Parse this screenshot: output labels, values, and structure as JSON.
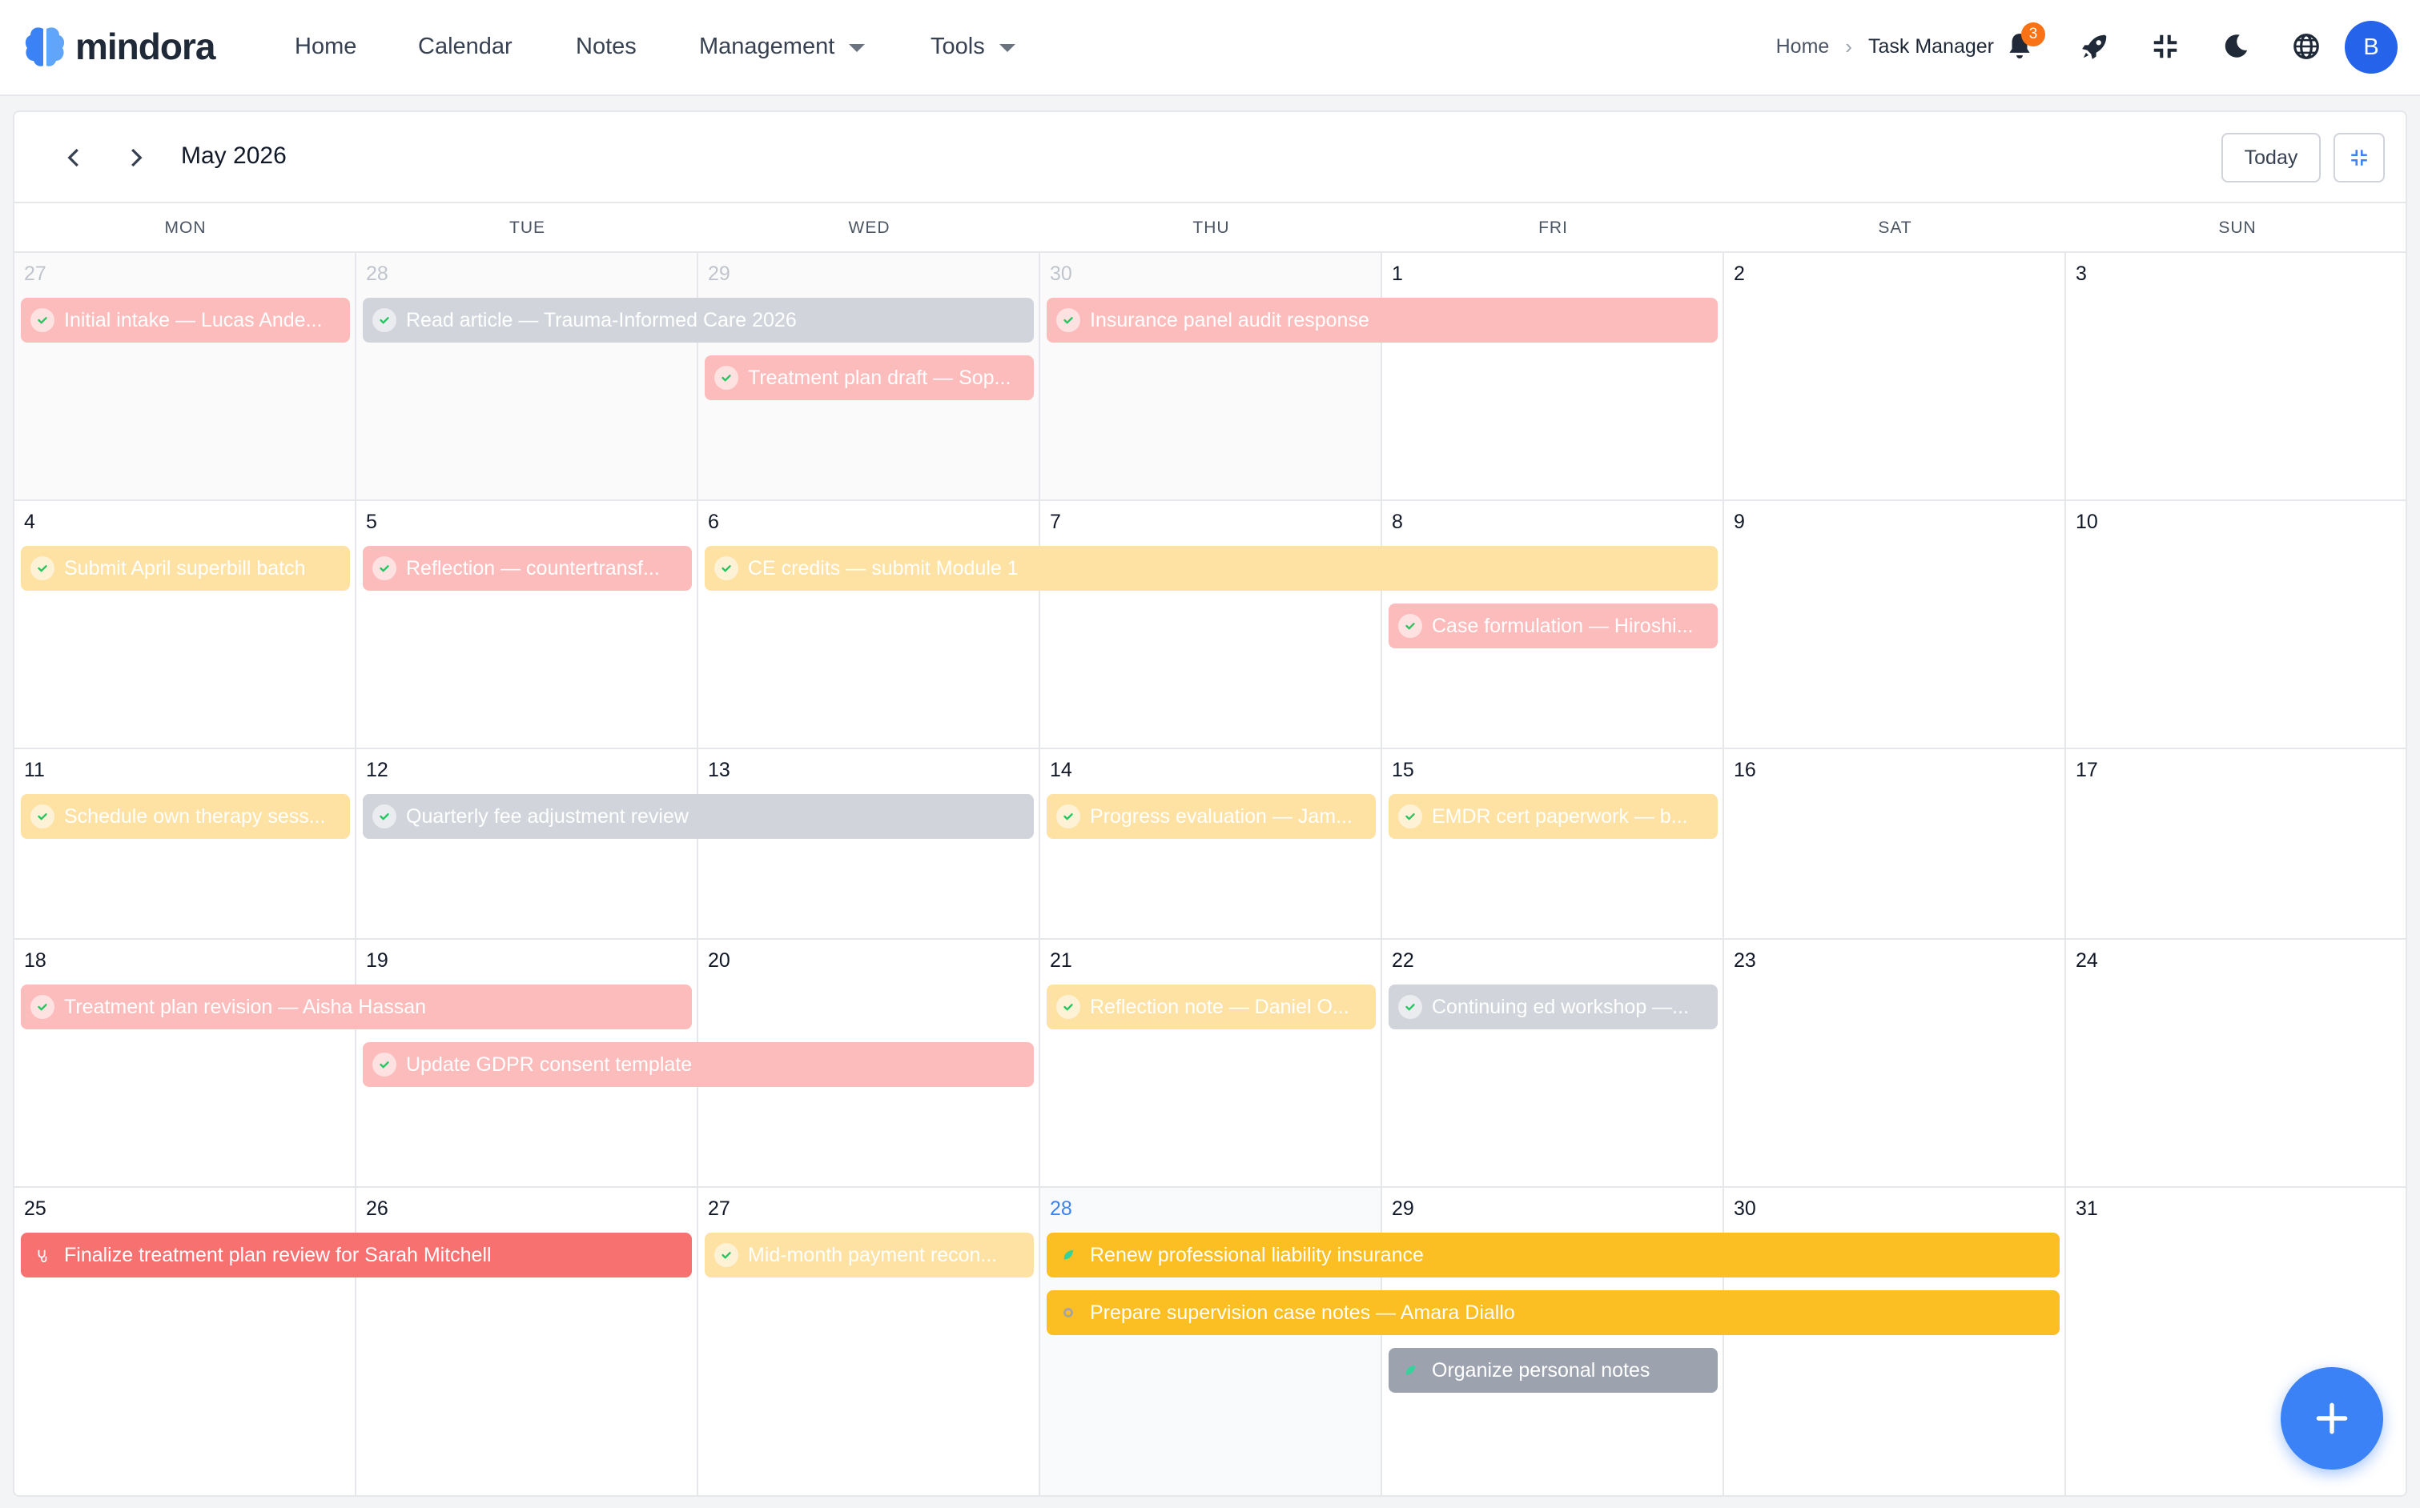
{
  "app": {
    "brand": "mindora"
  },
  "nav": {
    "items": [
      {
        "label": "Home",
        "dropdown": false
      },
      {
        "label": "Calendar",
        "dropdown": false
      },
      {
        "label": "Notes",
        "dropdown": false
      },
      {
        "label": "Management",
        "dropdown": true
      },
      {
        "label": "Tools",
        "dropdown": true
      }
    ]
  },
  "breadcrumb": {
    "home": "Home",
    "separator": "›",
    "current": "Task Manager"
  },
  "toolbar": {
    "notification_count": "3",
    "icons": [
      "bell-icon",
      "rocket-icon",
      "compress-icon",
      "moon-icon",
      "globe-icon"
    ],
    "avatar_initial": "B"
  },
  "calendar": {
    "month_title": "May 2026",
    "today_label": "Today",
    "weekdays": [
      "MON",
      "TUE",
      "WED",
      "THU",
      "FRI",
      "SAT",
      "SUN"
    ],
    "weeks": [
      [
        {
          "day": "27",
          "out": true
        },
        {
          "day": "28",
          "out": true
        },
        {
          "day": "29",
          "out": true
        },
        {
          "day": "30",
          "out": true
        },
        {
          "day": "1"
        },
        {
          "day": "2"
        },
        {
          "day": "3"
        }
      ],
      [
        {
          "day": "4"
        },
        {
          "day": "5"
        },
        {
          "day": "6"
        },
        {
          "day": "7"
        },
        {
          "day": "8"
        },
        {
          "day": "9"
        },
        {
          "day": "10"
        }
      ],
      [
        {
          "day": "11"
        },
        {
          "day": "12"
        },
        {
          "day": "13"
        },
        {
          "day": "14"
        },
        {
          "day": "15"
        },
        {
          "day": "16"
        },
        {
          "day": "17"
        }
      ],
      [
        {
          "day": "18"
        },
        {
          "day": "19"
        },
        {
          "day": "20"
        },
        {
          "day": "21"
        },
        {
          "day": "22"
        },
        {
          "day": "23"
        },
        {
          "day": "24"
        }
      ],
      [
        {
          "day": "25"
        },
        {
          "day": "26"
        },
        {
          "day": "27"
        },
        {
          "day": "28",
          "today": true
        },
        {
          "day": "29"
        },
        {
          "day": "30"
        },
        {
          "day": "31"
        }
      ]
    ],
    "events": [
      {
        "week": 0,
        "start": 0,
        "span": 1,
        "lane": 0,
        "status": "done",
        "color": "red",
        "label": "Initial intake — Lucas Ande..."
      },
      {
        "week": 0,
        "start": 1,
        "span": 2,
        "lane": 0,
        "status": "done",
        "color": "gray",
        "label": "Read article — Trauma-Informed Care 2026"
      },
      {
        "week": 0,
        "start": 3,
        "span": 2,
        "lane": 0,
        "status": "done",
        "color": "red",
        "label": "Insurance panel audit response"
      },
      {
        "week": 0,
        "start": 2,
        "span": 1,
        "lane": 1,
        "status": "done",
        "color": "red",
        "label": "Treatment plan draft — Sop..."
      },
      {
        "week": 1,
        "start": 0,
        "span": 1,
        "lane": 0,
        "status": "done",
        "color": "yellow",
        "label": "Submit April superbill batch"
      },
      {
        "week": 1,
        "start": 1,
        "span": 1,
        "lane": 0,
        "status": "done",
        "color": "red",
        "label": "Reflection — countertransf..."
      },
      {
        "week": 1,
        "start": 2,
        "span": 3,
        "lane": 0,
        "status": "done",
        "color": "yellow",
        "label": "CE credits — submit Module 1"
      },
      {
        "week": 1,
        "start": 4,
        "span": 1,
        "lane": 1,
        "status": "done",
        "color": "red",
        "label": "Case formulation — Hiroshi..."
      },
      {
        "week": 2,
        "start": 0,
        "span": 1,
        "lane": 0,
        "status": "done",
        "color": "yellow",
        "label": "Schedule own therapy sess..."
      },
      {
        "week": 2,
        "start": 1,
        "span": 2,
        "lane": 0,
        "status": "done",
        "color": "gray",
        "label": "Quarterly fee adjustment review"
      },
      {
        "week": 2,
        "start": 3,
        "span": 1,
        "lane": 0,
        "status": "done",
        "color": "yellow",
        "label": "Progress evaluation — Jam..."
      },
      {
        "week": 2,
        "start": 4,
        "span": 1,
        "lane": 0,
        "status": "done",
        "color": "yellow",
        "label": "EMDR cert paperwork — b..."
      },
      {
        "week": 3,
        "start": 0,
        "span": 2,
        "lane": 0,
        "status": "done",
        "color": "red",
        "label": "Treatment plan revision — Aisha Hassan"
      },
      {
        "week": 3,
        "start": 3,
        "span": 1,
        "lane": 0,
        "status": "done",
        "color": "yellow",
        "label": "Reflection note — Daniel O..."
      },
      {
        "week": 3,
        "start": 4,
        "span": 1,
        "lane": 0,
        "status": "done",
        "color": "gray",
        "label": "Continuing ed workshop —..."
      },
      {
        "week": 3,
        "start": 1,
        "span": 2,
        "lane": 1,
        "status": "done",
        "color": "red",
        "label": "Update GDPR consent template"
      },
      {
        "week": 4,
        "start": 0,
        "span": 2,
        "lane": 0,
        "status": "active",
        "color": "red",
        "icon": "stethoscope-icon",
        "label": "Finalize treatment plan review for Sarah Mitchell"
      },
      {
        "week": 4,
        "start": 2,
        "span": 1,
        "lane": 0,
        "status": "done",
        "color": "yellow",
        "label": "Mid-month payment recon..."
      },
      {
        "week": 4,
        "start": 3,
        "span": 3,
        "lane": 0,
        "status": "active",
        "color": "yellow",
        "icon": "leaf-icon",
        "label": "Renew professional liability insurance"
      },
      {
        "week": 4,
        "start": 3,
        "span": 3,
        "lane": 1,
        "status": "active",
        "color": "yellow",
        "icon": "gear-icon",
        "label": "Prepare supervision case notes — Amara Diallo"
      },
      {
        "week": 4,
        "start": 4,
        "span": 1,
        "lane": 2,
        "status": "active",
        "color": "gray",
        "icon": "leaf-icon",
        "label": "Organize personal notes"
      }
    ]
  },
  "colors": {
    "red_done": "#fdbcbc",
    "red_active": "#f87171",
    "yellow_done": "#fde2a4",
    "yellow_active": "#fbbf24",
    "gray_done": "#d1d5db",
    "gray_active": "#9ca3af",
    "accent": "#3b82f6",
    "check_green": "#22c55e"
  }
}
